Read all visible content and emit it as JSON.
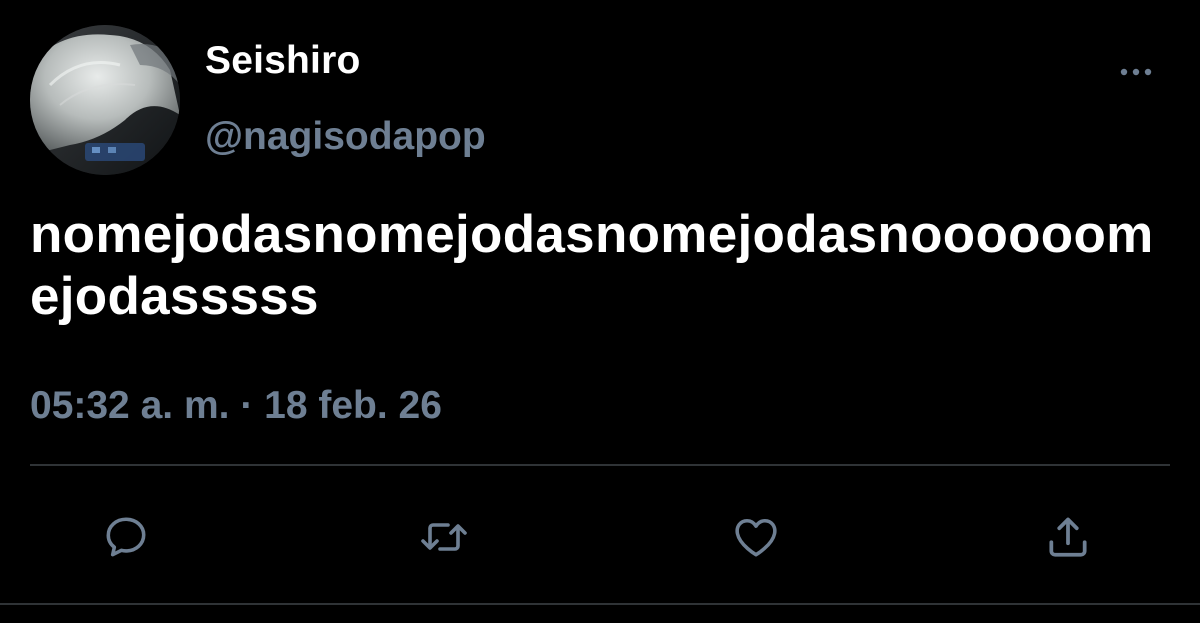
{
  "colors": {
    "background": "#000000",
    "primary_text": "#ffffff",
    "secondary_text": "#6e7f93",
    "divider": "#2f3336"
  },
  "tweet": {
    "author": {
      "display_name": "Seishiro",
      "handle": "@nagisodapop",
      "avatar": "profile-photo"
    },
    "text": "nomejodasnomejodasnomejodasnoooooomejodasssss",
    "time": "05:32 a. m.",
    "separator": "·",
    "date": "18 feb. 26"
  },
  "menu": {
    "icon": "more-icon"
  },
  "actions": [
    {
      "icon": "reply-icon"
    },
    {
      "icon": "retweet-icon"
    },
    {
      "icon": "like-icon"
    },
    {
      "icon": "share-icon"
    }
  ]
}
